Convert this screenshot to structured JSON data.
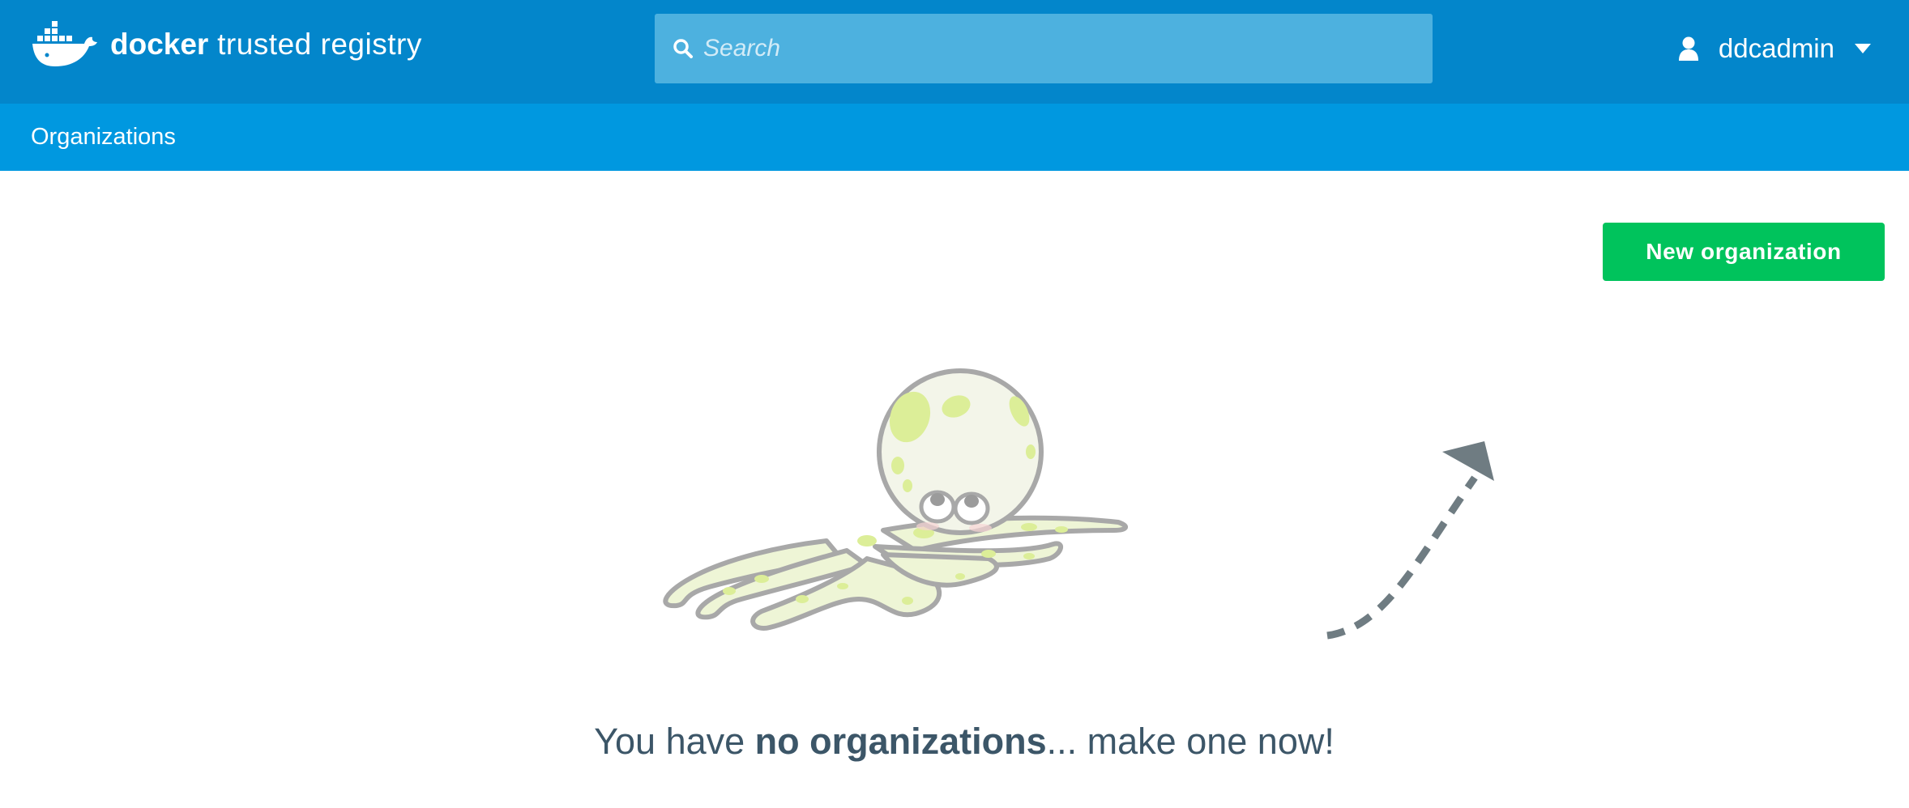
{
  "header": {
    "brand_bold": "docker",
    "brand_light": "trusted registry",
    "search_placeholder": "Search",
    "username": "ddcadmin",
    "icons": {
      "logo": "docker-whale-logo",
      "search": "search-icon",
      "user": "user-icon",
      "caret": "caret-down-icon"
    }
  },
  "subnav": {
    "title": "Organizations"
  },
  "actions": {
    "new_org_label": "New organization"
  },
  "empty_state": {
    "illustration": "octopus-illustration",
    "arrow": "dashed-arrow-pointing-up-right",
    "message_prefix": "You have ",
    "message_bold": "no organizations",
    "message_suffix": "... make one now!"
  },
  "colors": {
    "topbar": "#0386cb",
    "subnav": "#0098e0",
    "search_bg": "#4db1df",
    "primary_button": "#00c35c",
    "message_text": "#3c5668",
    "arrow": "#6f7c82"
  }
}
